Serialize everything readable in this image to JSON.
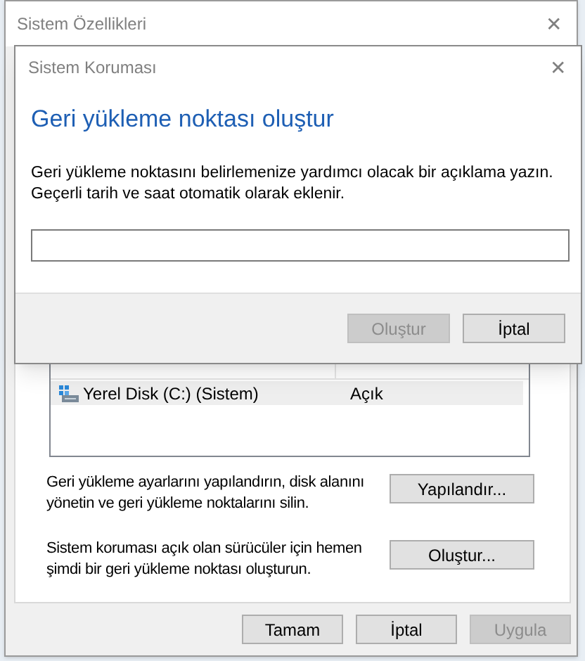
{
  "back_window": {
    "title": "Sistem Özellikleri",
    "close": "✕",
    "drives": [
      {
        "name": "Yerel Disk (C:) (Sistem)",
        "protection": "Açık",
        "selected": true
      }
    ],
    "actions": [
      {
        "text": "Geri yükleme ayarlarını yapılandırın, disk alanını yönetin ve geri yükleme noktalarını silin.",
        "button": "Yapılandır..."
      },
      {
        "text": "Sistem koruması açık olan sürücüler için hemen şimdi bir geri yükleme noktası oluşturun.",
        "button": "Oluştur..."
      }
    ],
    "buttons": [
      {
        "label": "Tamam",
        "disabled": false
      },
      {
        "label": "İptal",
        "disabled": false
      },
      {
        "label": "Uygula",
        "disabled": true
      }
    ]
  },
  "dialog": {
    "title": "Sistem Koruması",
    "close": "✕",
    "heading": "Geri yükleme noktası oluştur",
    "description": "Geri yükleme noktasını belirlemenize yardımcı olacak bir açıklama yazın. Geçerli tarih ve saat otomatik olarak eklenir.",
    "buttons": [
      {
        "label": "Oluştur",
        "disabled": true
      },
      {
        "label": "İptal",
        "disabled": false
      }
    ]
  }
}
